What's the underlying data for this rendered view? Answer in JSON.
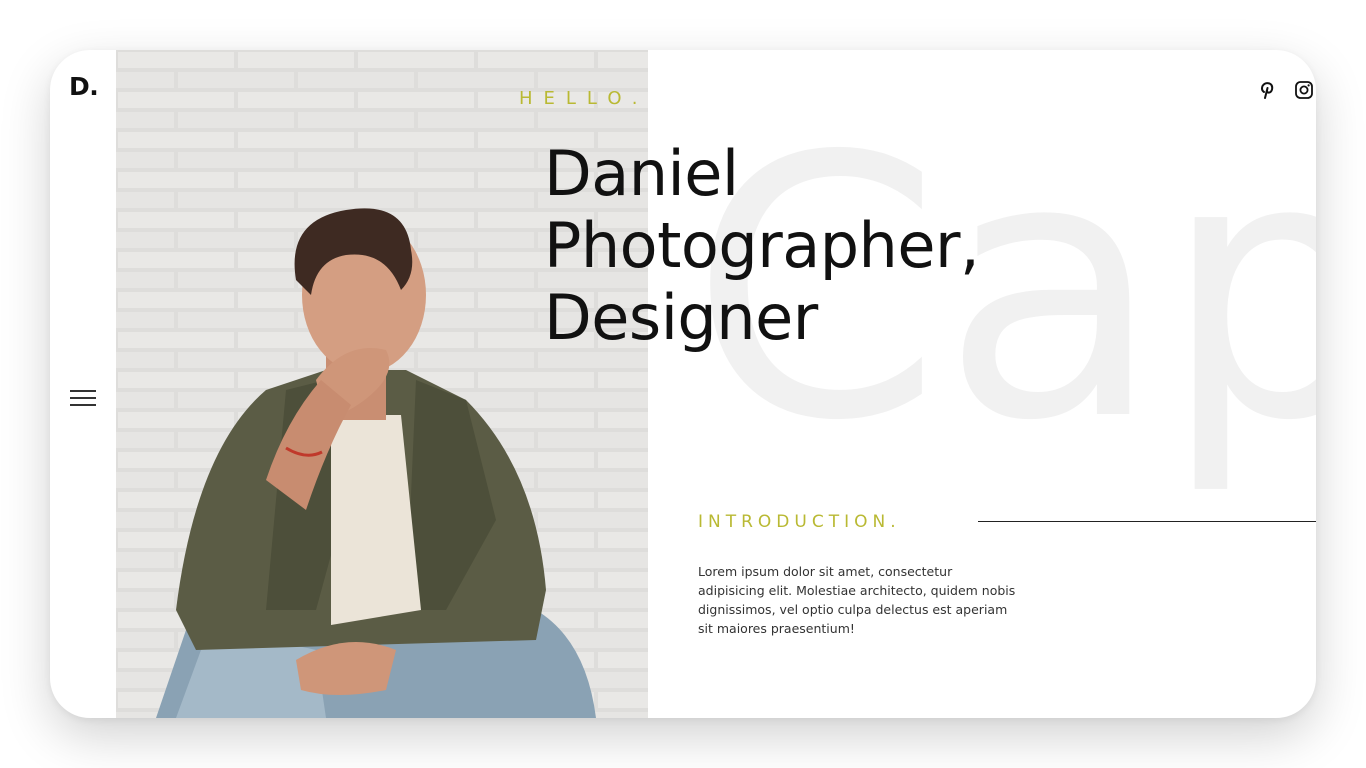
{
  "brand": {
    "logo": "D."
  },
  "hero": {
    "background_word": "Capt",
    "greeting": "HELLO.",
    "headline": [
      "Daniel",
      "Photographer,",
      "Designer"
    ]
  },
  "intro": {
    "label": "INTRODUCTION.",
    "text": "Lorem ipsum dolor sit amet, consectetur adipisicing elit. Molestiae architecto, quidem nobis dignissimos, vel optio culpa delectus est aperiam sit maiores praesentium!"
  },
  "nav": {
    "menu_icon": "hamburger-menu-icon"
  },
  "social": [
    {
      "icon": "pinterest-icon"
    },
    {
      "icon": "instagram-icon"
    }
  ],
  "colors": {
    "accent": "#b9b933",
    "text": "#111111",
    "background_word": "#f1f1f1"
  }
}
